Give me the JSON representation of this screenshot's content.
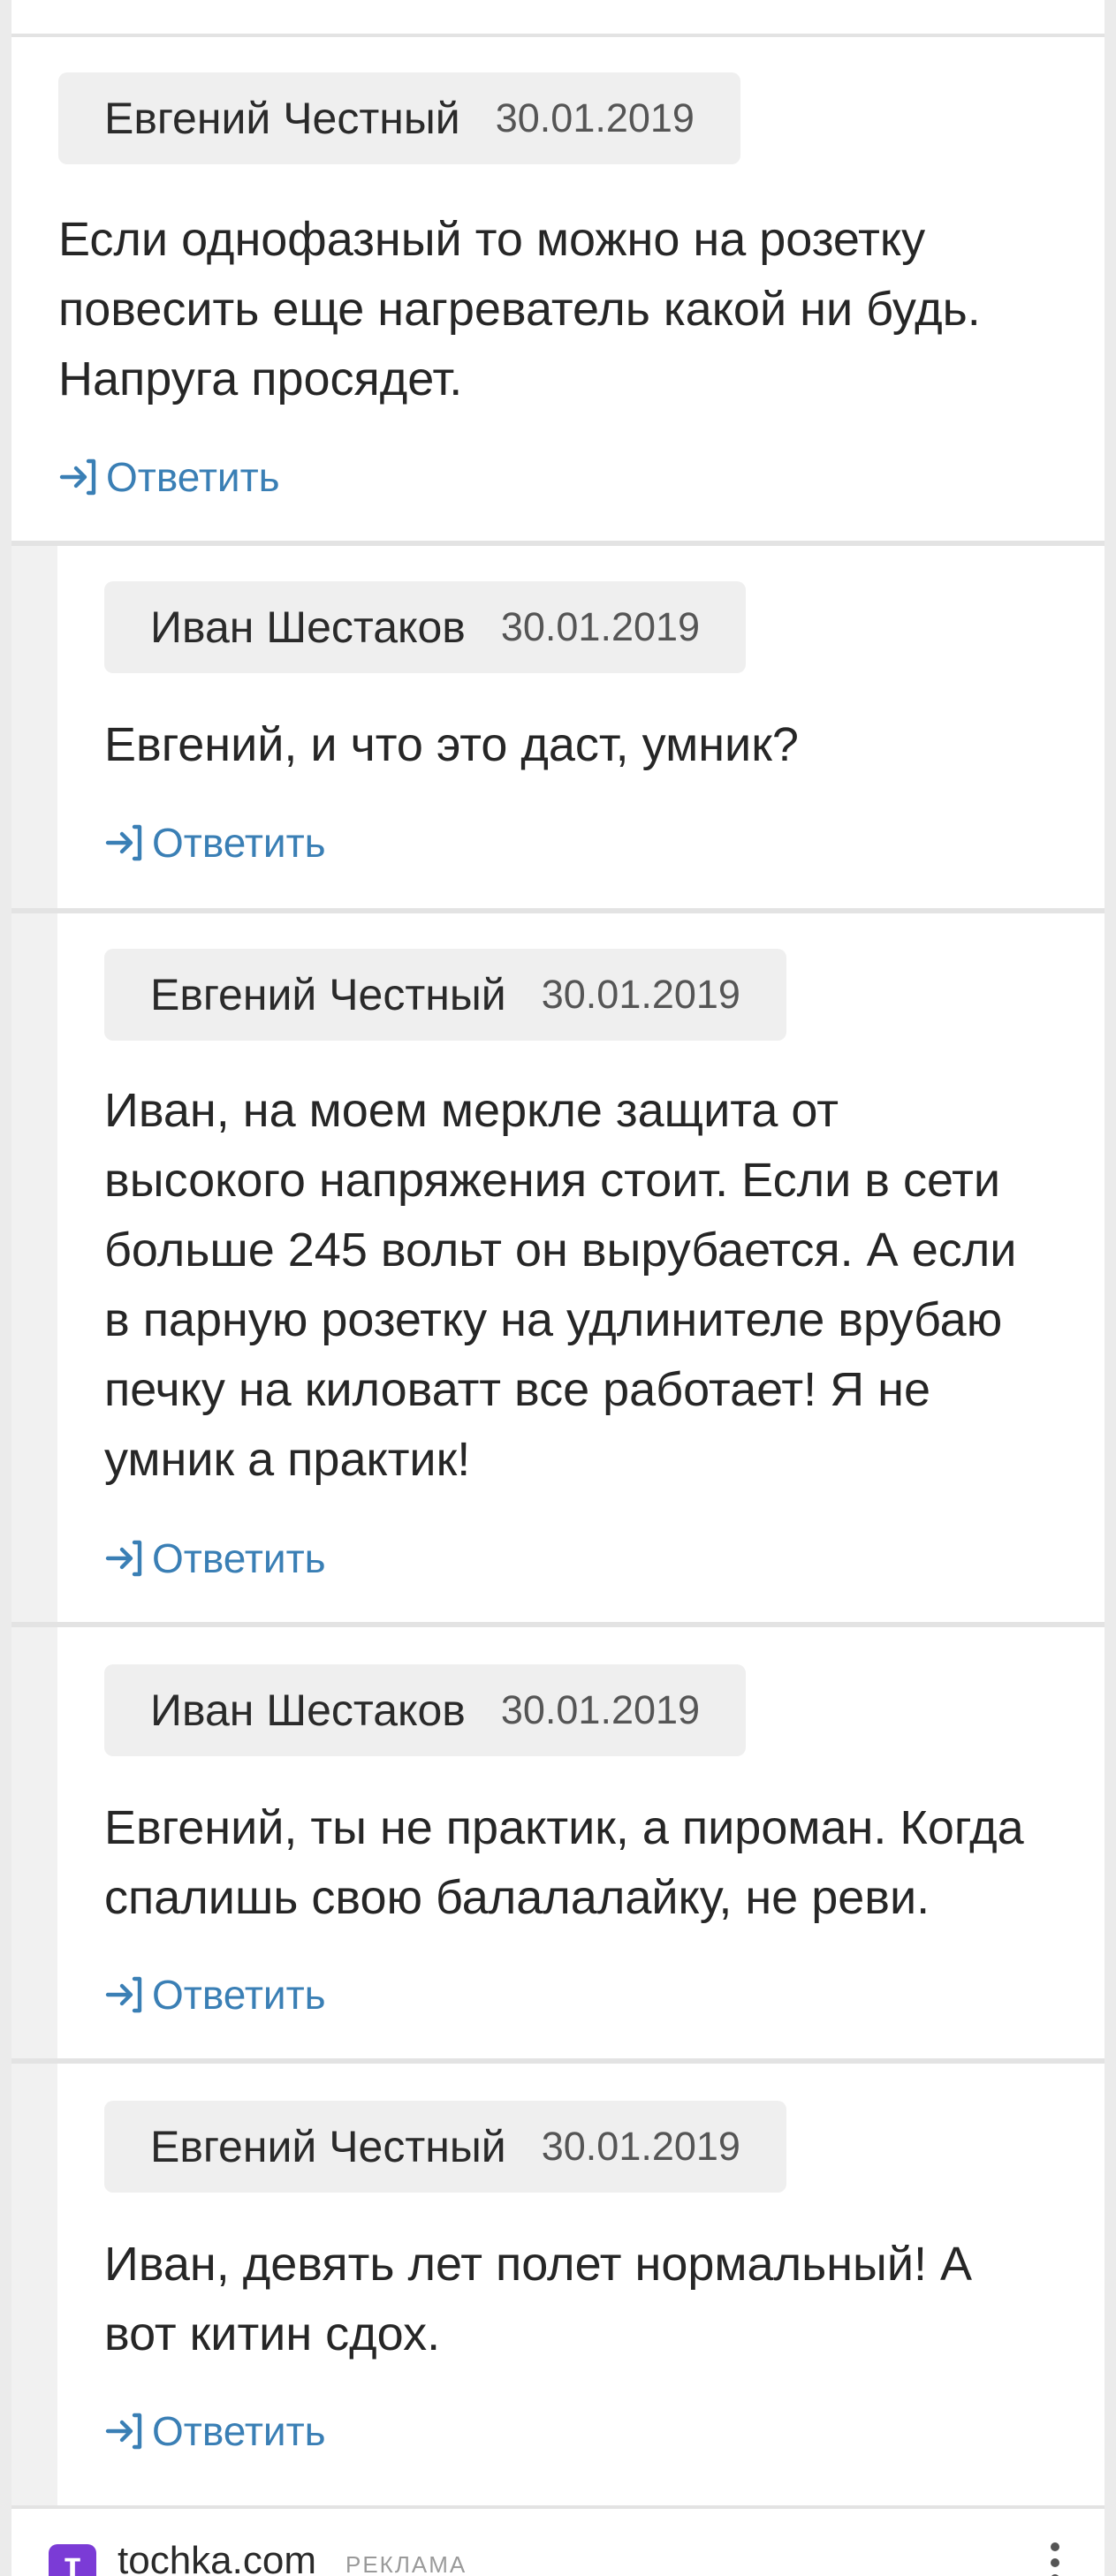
{
  "reply_label": "Ответить",
  "accent_color": "#3a7fb5",
  "comments": [
    {
      "author": "Евгений Честный",
      "date": "30.01.2019",
      "text": "Если однофазный то можно на розетку повесить еще нагреватель какой ни будь. Напруга просядет.",
      "reply": "Ответить"
    },
    {
      "author": "Иван Шестаков",
      "date": "30.01.2019",
      "text": "Евгений, и что это даст, умник?",
      "reply": "Ответить"
    },
    {
      "author": "Евгений Честный",
      "date": "30.01.2019",
      "text": "Иван, на моем меркле защита от высокого напряжения стоит. Если в сети больше 245 вольт он вырубается. А если в парную розетку на удлинителе врубаю печку на киловатт все работает! Я не умник а практик!",
      "reply": "Ответить"
    },
    {
      "author": "Иван Шестаков",
      "date": "30.01.2019",
      "text": "Евгений, ты не практик, а пироман. Когда спалишь свою балалалайку, не реви.",
      "reply": "Ответить"
    },
    {
      "author": "Евгений Честный",
      "date": "30.01.2019",
      "text": "Иван, девять лет полет нормальный! А вот китин сдох.",
      "reply": "Ответить"
    }
  ],
  "ad": {
    "logo_letter": "т",
    "domain": "tochka.com",
    "tag": "РЕКЛАМА"
  }
}
